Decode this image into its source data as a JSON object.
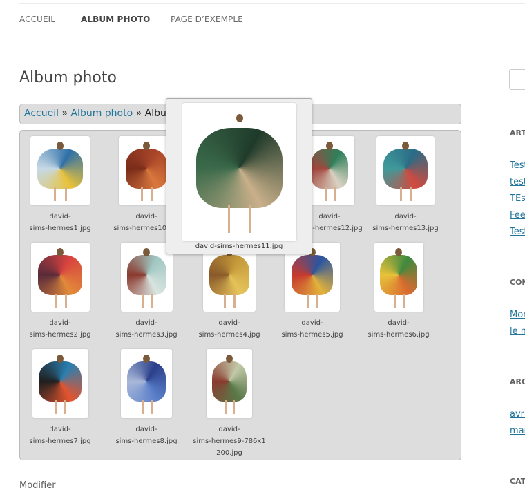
{
  "nav": {
    "items": [
      "ACCUEIL",
      "ALBUM PHOTO",
      "PAGE D’EXEMPLE"
    ]
  },
  "page_title": "Album photo",
  "breadcrumb": {
    "home": "Accueil",
    "sep1": "»",
    "parent": "Album photo",
    "sep2": "»",
    "current": "Album photo"
  },
  "gallery": {
    "items": [
      {
        "caption1": "david-",
        "caption2": "sims-hermes1.jpg",
        "colors": [
          "#2e6fa8",
          "#e8c23a",
          "#c6d9e6"
        ]
      },
      {
        "caption1": "david-",
        "caption2": "sims-hermes10.jpg",
        "colors": [
          "#a9462a",
          "#d9773d",
          "#7a2c1a"
        ]
      },
      {
        "caption1": "david-",
        "caption2": "sims-hermes12.jpg",
        "colors": [
          "#2f7f5a",
          "#d9d2c2",
          "#a3463d"
        ]
      },
      {
        "caption1": "david-",
        "caption2": "sims-hermes13.jpg",
        "colors": [
          "#2a6b86",
          "#d24a3e",
          "#3f9a9a"
        ]
      },
      {
        "caption1": "david-",
        "caption2": "sims-hermes2.jpg",
        "colors": [
          "#d8433f",
          "#e28a3a",
          "#5a2b3a"
        ]
      },
      {
        "caption1": "david-",
        "caption2": "sims-hermes3.jpg",
        "colors": [
          "#9fc7c2",
          "#d9e4e0",
          "#8b3a2f"
        ]
      },
      {
        "caption1": "david-",
        "caption2": "sims-hermes4.jpg",
        "colors": [
          "#c49a3a",
          "#e6c35a",
          "#8a5a2a"
        ]
      },
      {
        "caption1": "david-",
        "caption2": "sims-hermes5.jpg",
        "colors": [
          "#2b55a0",
          "#e2b23a",
          "#c63a2f"
        ]
      },
      {
        "caption1": "david-",
        "caption2": "sims-hermes6.jpg",
        "colors": [
          "#3f8a3f",
          "#d96a2f",
          "#e8c23a"
        ]
      },
      {
        "caption1": "david-",
        "caption2": "sims-hermes7.jpg",
        "colors": [
          "#2a7fb0",
          "#e2542f",
          "#1f1f1f"
        ]
      },
      {
        "caption1": "david-",
        "caption2": "sims-hermes8.jpg",
        "colors": [
          "#2b3f8a",
          "#5b7fc9",
          "#a8b8d9"
        ]
      },
      {
        "caption1": "david-",
        "caption2": "sims-hermes9-786x1",
        "caption3": "200.jpg",
        "colors": [
          "#c2c9a8",
          "#5a7a4a",
          "#8a3a2f"
        ]
      }
    ]
  },
  "popup": {
    "caption": "david-sims-hermes11.jpg",
    "colors": [
      "#1f3a2a",
      "#c9b08a",
      "#3a6a4a"
    ]
  },
  "edit_link": "Modifier",
  "sidebar": {
    "headings": [
      "ART",
      "COM",
      "ARC",
      "CAT"
    ],
    "links1": [
      "Test",
      "test",
      "TEst",
      "Fee",
      "Test"
    ],
    "links2": [
      "Mon",
      "le m"
    ],
    "links3": [
      "avri",
      "mar"
    ]
  }
}
